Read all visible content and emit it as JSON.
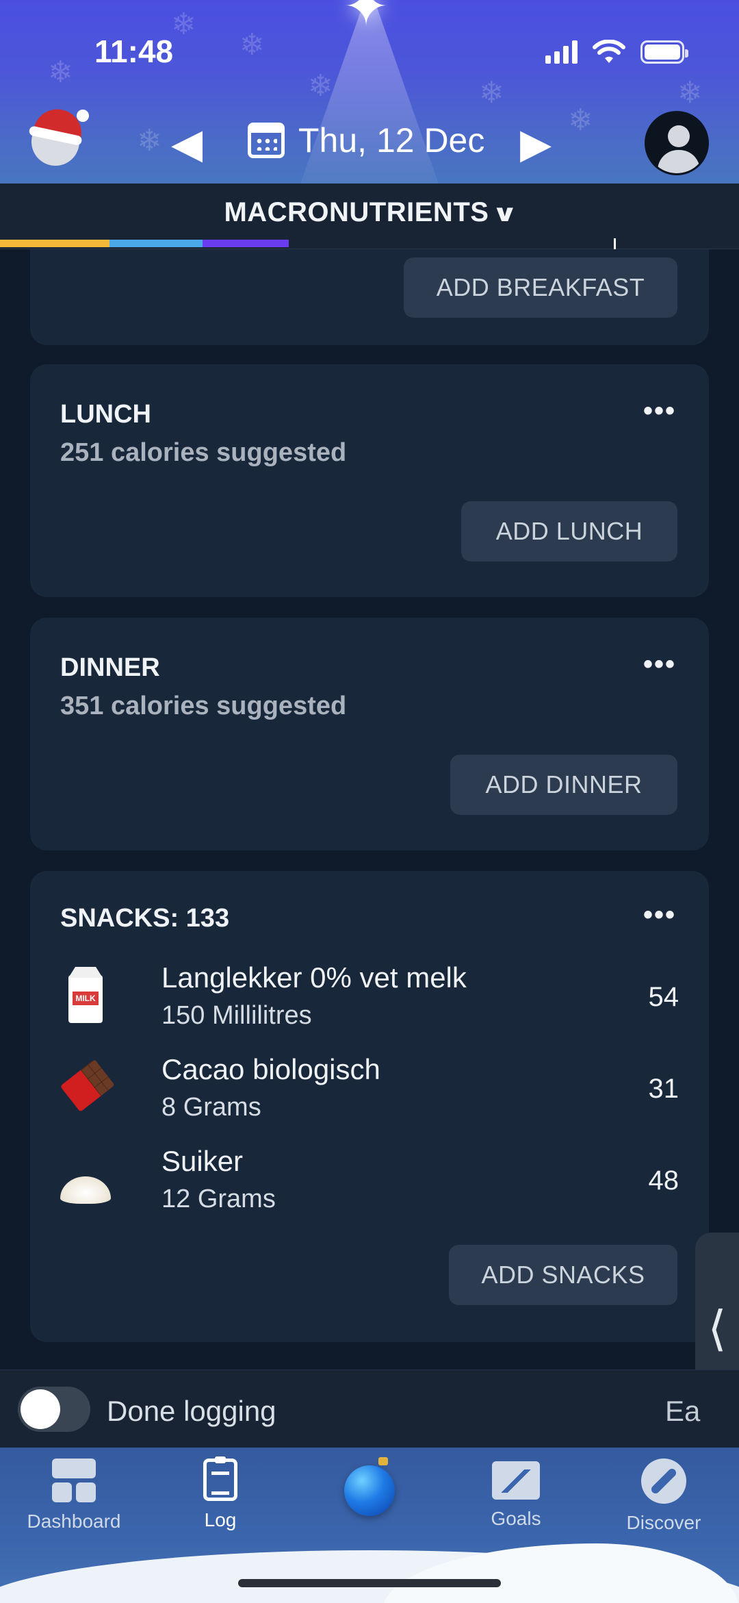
{
  "status": {
    "time": "11:48"
  },
  "header": {
    "date": "Thu, 12 Dec"
  },
  "macro": {
    "title": "MACRONUTRIENTS",
    "segments": [
      {
        "color": "#f5b93a",
        "fraction": 0.148
      },
      {
        "color": "#4aa8e8",
        "fraction": 0.126
      },
      {
        "color": "#6a3cf0",
        "fraction": 0.117
      }
    ]
  },
  "meals": {
    "breakfast": {
      "button": "ADD BREAKFAST"
    },
    "lunch": {
      "title": "LUNCH",
      "suggestion": "251 calories suggested",
      "button": "ADD LUNCH"
    },
    "dinner": {
      "title": "DINNER",
      "suggestion": "351 calories suggested",
      "button": "ADD DINNER"
    },
    "snacks": {
      "title": "SNACKS: 133",
      "button": "ADD SNACKS",
      "items": [
        {
          "name": "Langlekker 0% vet melk",
          "quantity": "150 Millilitres",
          "calories": "54",
          "icon": "milk-carton-icon",
          "icon_text": "MILK"
        },
        {
          "name": "Cacao biologisch",
          "quantity": "8 Grams",
          "calories": "31",
          "icon": "chocolate-bar-icon"
        },
        {
          "name": "Suiker",
          "quantity": "12 Grams",
          "calories": "48",
          "icon": "sugar-pile-icon"
        }
      ]
    }
  },
  "more_icon": "•••",
  "done_logging": {
    "label": "Done logging",
    "edit": "Ea"
  },
  "side_handle": "⟨",
  "tabs": [
    {
      "label": "Dashboard",
      "icon": "dashboard-icon"
    },
    {
      "label": "Log",
      "icon": "clipboard-icon"
    },
    {
      "label": "",
      "icon": "ornament-icon"
    },
    {
      "label": "Goals",
      "icon": "goals-icon"
    },
    {
      "label": "Discover",
      "icon": "compass-icon"
    }
  ]
}
